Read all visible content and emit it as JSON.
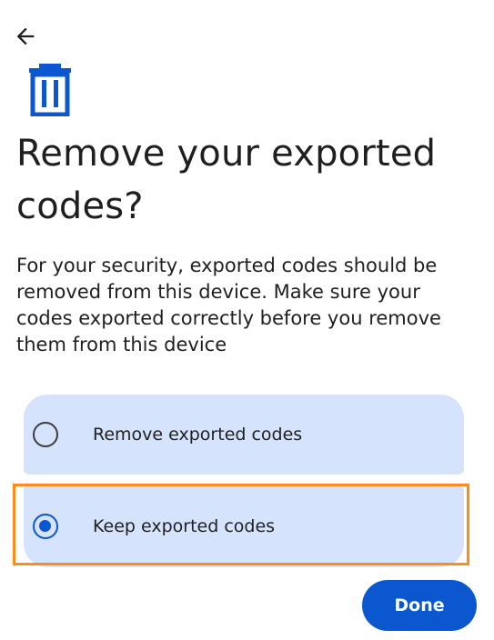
{
  "header": {
    "back_icon": "arrow-left-icon",
    "page_icon": "trash-icon",
    "accent_color": "#0b57d0"
  },
  "title": "Remove your exported codes?",
  "description": "For your security, exported codes should be removed from this device. Make sure your codes exported correctly before you remove them from this device",
  "options": [
    {
      "label": "Remove exported codes",
      "selected": false
    },
    {
      "label": "Keep exported codes",
      "selected": true
    }
  ],
  "highlight_color": "#ff8c1a",
  "done_button": {
    "label": "Done"
  }
}
